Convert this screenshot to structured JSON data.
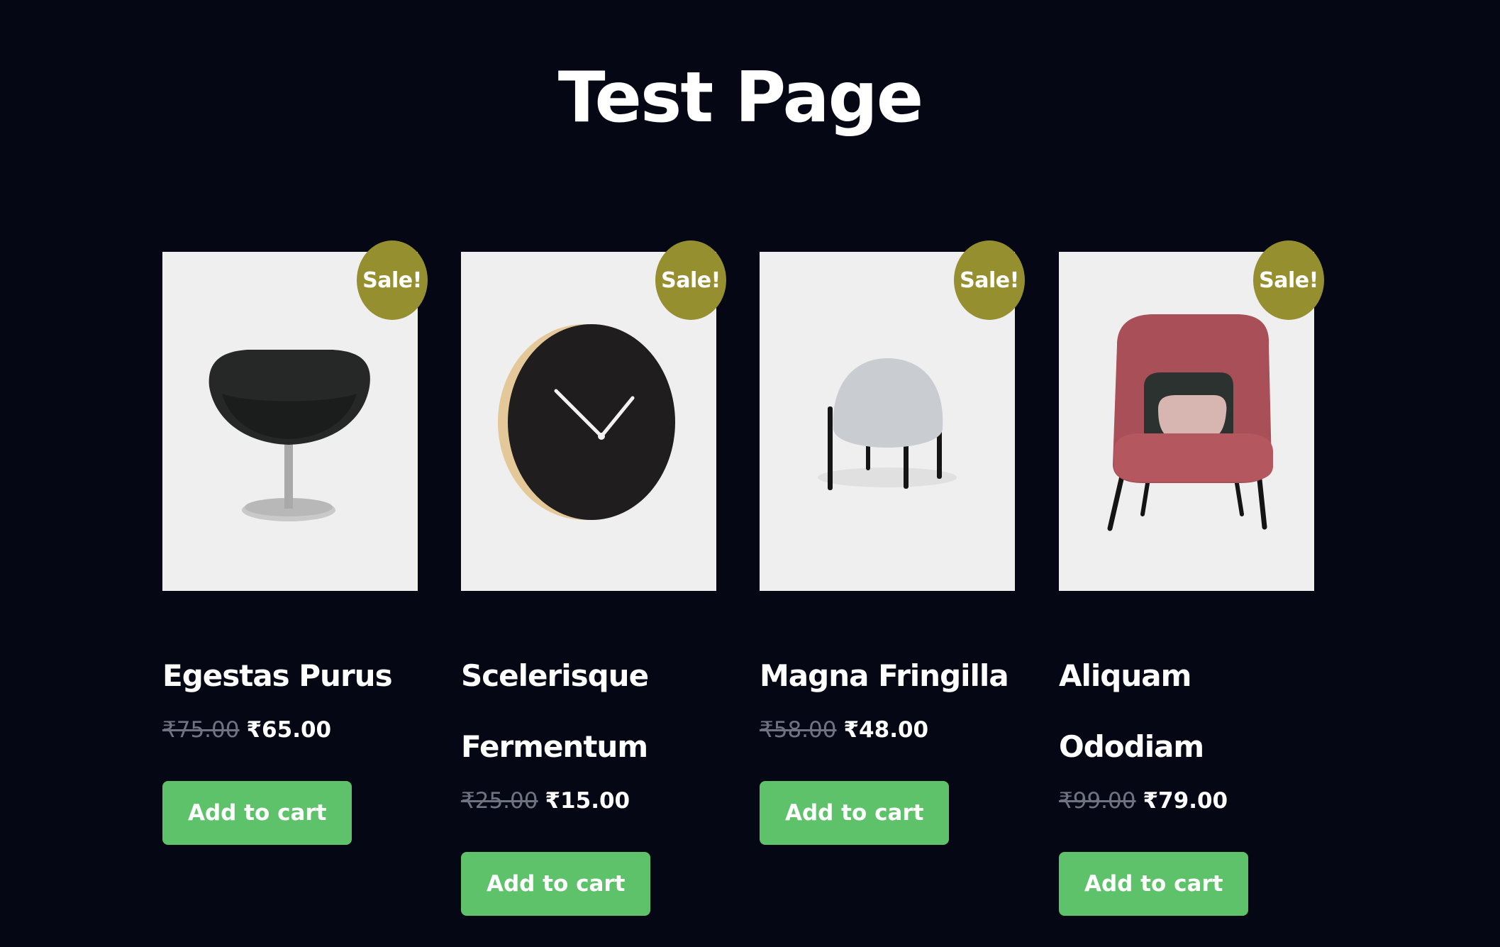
{
  "page": {
    "title": "Test Page",
    "background": "#050814"
  },
  "accent": {
    "sale_badge": "#968f2f",
    "button": "#5ec26a",
    "image_bg": "#efefef"
  },
  "products": [
    {
      "name": "Egestas Purus",
      "badge": "Sale!",
      "old_price": "₹75.00",
      "price": "₹65.00",
      "button": "Add to cart",
      "image": "egg-chair-image"
    },
    {
      "name": "Scelerisque Fermentum",
      "badge": "Sale!",
      "old_price": "₹25.00",
      "price": "₹15.00",
      "button": "Add to cart",
      "image": "wall-clock-image"
    },
    {
      "name": "Magna Fringilla",
      "badge": "Sale!",
      "old_price": "₹58.00",
      "price": "₹48.00",
      "button": "Add to cart",
      "image": "pouf-stool-image"
    },
    {
      "name": "Aliquam Ododiam",
      "badge": "Sale!",
      "old_price": "₹99.00",
      "price": "₹79.00",
      "button": "Add to cart",
      "image": "armchair-image"
    }
  ]
}
